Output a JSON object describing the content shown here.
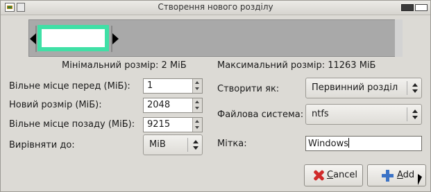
{
  "window": {
    "title": "Створення нового розділу"
  },
  "partition_bar": {
    "partition_color": "#3fe0a6",
    "unallocated_color": "#a9a9a9"
  },
  "sizes": {
    "min_label": "Мінімальний розмір: 2 МіБ",
    "max_label": "Максимальний розмір: 11263 МіБ"
  },
  "fields": {
    "free_before_label": "Вільне місце перед (МіБ):",
    "free_before_value": "1",
    "new_size_label": "Новий розмір (МіБ):",
    "new_size_value": "2048",
    "free_after_label": "Вільне місце позаду (МіБ):",
    "free_after_value": "9215",
    "align_label": "Вирівняти до:",
    "align_value": "MiB"
  },
  "right": {
    "create_as_label": "Створити як:",
    "create_as_value": "Первинний розділ",
    "filesystem_label": "Файлова система:",
    "filesystem_value": "ntfs",
    "label_label": "Мітка:",
    "label_value": "Windows"
  },
  "buttons": {
    "cancel_first": "C",
    "cancel_rest": "ancel",
    "add_first": "A",
    "add_rest": "dd"
  }
}
